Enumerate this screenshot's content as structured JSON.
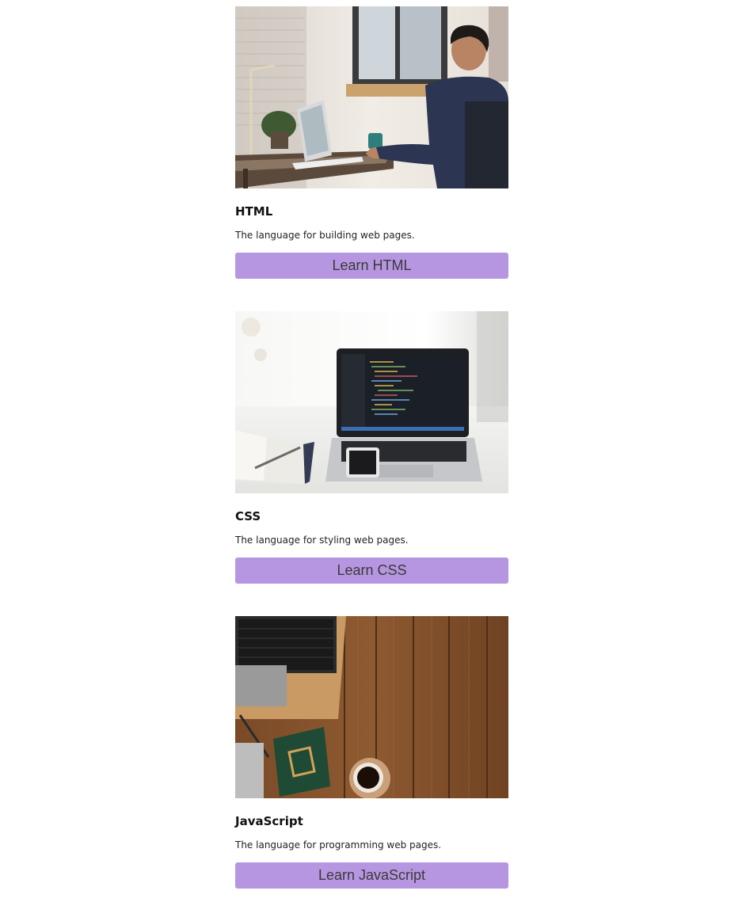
{
  "cards": [
    {
      "title": "HTML",
      "description": "The language for building web pages.",
      "button_label": "Learn HTML",
      "image": "man-working-on-laptop-photo"
    },
    {
      "title": "CSS",
      "description": "The language for styling web pages.",
      "button_label": "Learn CSS",
      "image": "laptop-with-code-on-desk-photo"
    },
    {
      "title": "JavaScript",
      "description": "The language for programming web pages.",
      "button_label": "Learn JavaScript",
      "image": "wooden-desk-with-laptop-and-coffee-photo"
    }
  ],
  "colors": {
    "button_bg": "#b696e0",
    "button_text": "#3a3a3a",
    "title_text": "#111111"
  }
}
